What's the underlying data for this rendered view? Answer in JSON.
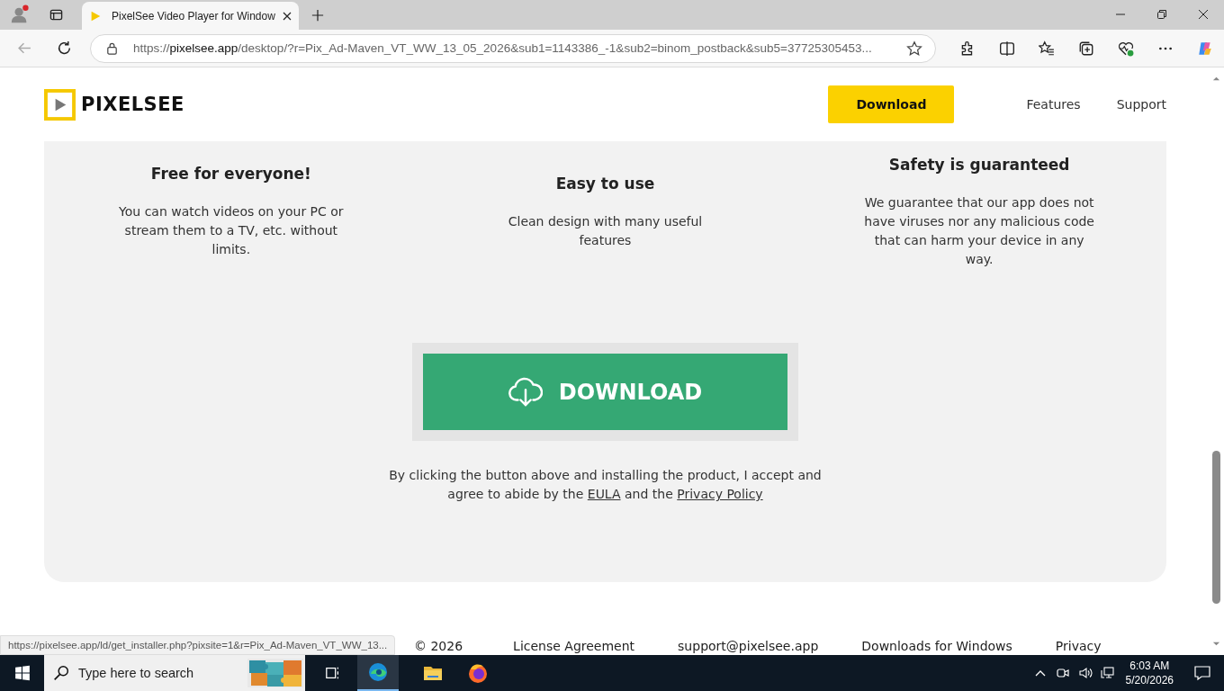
{
  "browser": {
    "tabs": [
      {
        "title": "PixelSee Video Player for Window",
        "selected": true
      }
    ],
    "address": {
      "scheme": "https://",
      "host": "pixelsee.app",
      "path": "/desktop/?r=Pix_Ad-Maven_VT_WW_13_05_2026&sub1=1143386_-1&sub2=binom_postback&sub5=37725305453..."
    },
    "status_url": "https://pixelsee.app/ld/get_installer.php?pixsite=1&r=Pix_Ad-Maven_VT_WW_13..."
  },
  "header": {
    "logo": "PIXELSEE",
    "nav": [
      {
        "label": "Download",
        "kind": "primary"
      },
      {
        "label": "Features",
        "kind": "link"
      },
      {
        "label": "Support",
        "kind": "link"
      }
    ]
  },
  "features": [
    {
      "title": "Free for everyone!",
      "text": "You can watch videos on your PC or stream them to a TV, etc. without limits."
    },
    {
      "title": "Easy to use",
      "text": "Clean design with many useful features"
    },
    {
      "title": "Safety is guaranteed",
      "text": "We guarantee that our app does not have viruses nor any malicious code that can harm your device in any way."
    }
  ],
  "download": {
    "label": "DOWNLOAD",
    "consent": [
      {
        "kind": "text",
        "text": "By clicking the button above and installing the product, I accept and agree to abide by the "
      },
      {
        "kind": "link",
        "text": "EULA"
      },
      {
        "kind": "text",
        "text": " and the "
      },
      {
        "kind": "link",
        "text": "Privacy Policy"
      }
    ]
  },
  "footer": [
    "© 2026",
    "License Agreement",
    "support@pixelsee.app",
    "Downloads for Windows",
    "Privacy"
  ],
  "taskbar": {
    "search_placeholder": "Type here to search",
    "time": "6:03 AM",
    "date": "5/20/2026"
  }
}
